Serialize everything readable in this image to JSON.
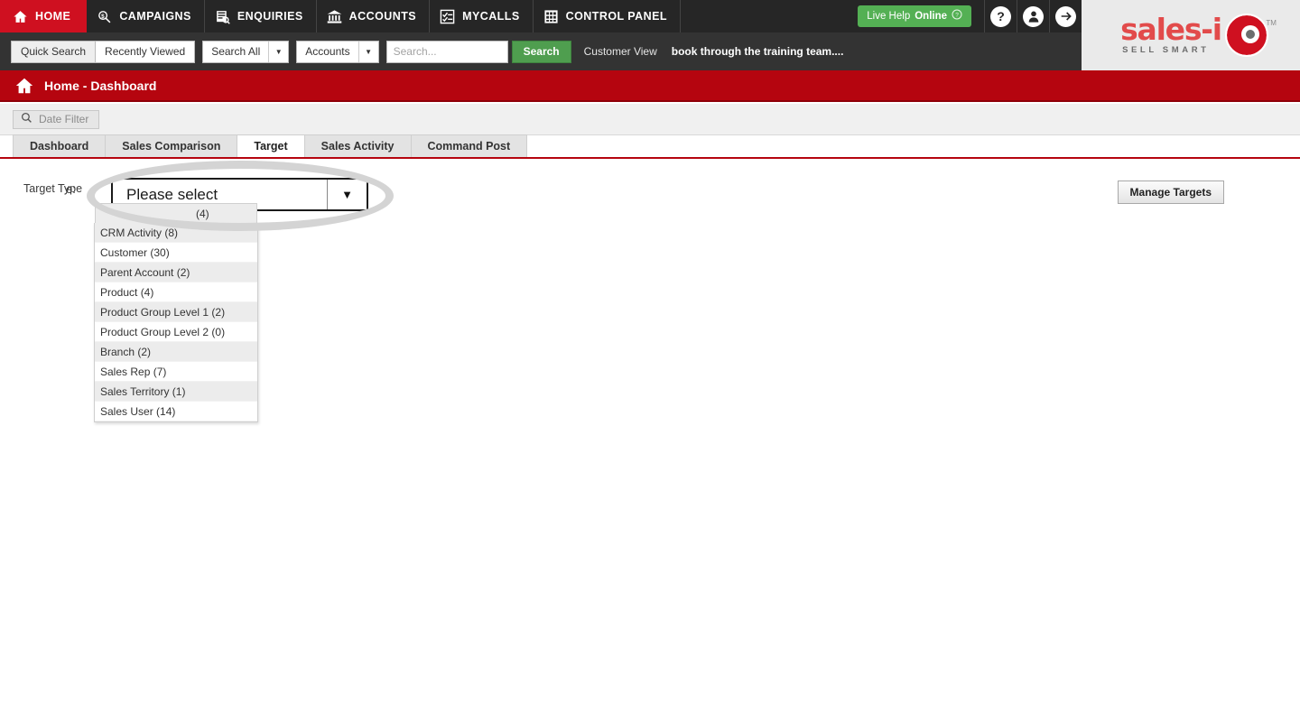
{
  "topnav": {
    "items": [
      {
        "label": "HOME",
        "icon": "home-icon",
        "active": true
      },
      {
        "label": "CAMPAIGNS",
        "icon": "campaigns-icon",
        "active": false
      },
      {
        "label": "ENQUIRIES",
        "icon": "enquiries-icon",
        "active": false
      },
      {
        "label": "ACCOUNTS",
        "icon": "accounts-bank-icon",
        "active": false
      },
      {
        "label": "MYCALLS",
        "icon": "mycalls-checklist-icon",
        "active": false
      },
      {
        "label": "CONTROL PANEL",
        "icon": "control-panel-grid-icon",
        "active": false
      }
    ],
    "live_help": {
      "prefix": "Live Help",
      "status": "Online",
      "icon": "help-circle-icon"
    },
    "help_icon": "question-mark-icon",
    "account_icon": "user-avatar-icon",
    "logout_icon": "arrow-right-logout-icon"
  },
  "logo": {
    "main": "sales-i",
    "sub": "SELL SMART",
    "trademark": "TM",
    "mark_icon": "eye-logo-icon",
    "brand_red": "#cf1020",
    "brand_text_red": "#e24b4b"
  },
  "searchbar": {
    "quick_search_label": "Quick Search",
    "recently_viewed_label": "Recently Viewed",
    "scope_label": "Search All",
    "entity_label": "Accounts",
    "search_placeholder": "Search...",
    "search_value": "",
    "search_button_label": "Search",
    "customer_view_label": "Customer View",
    "marquee_text": "book through the training team....",
    "search_green": "#4f9e4f"
  },
  "breadcrumb": {
    "icon": "home-icon",
    "title": "Home - Dashboard",
    "bar_red": "#b5050f"
  },
  "filterstrip": {
    "date_filter_label": "Date Filter",
    "date_filter_icon": "magnifier-icon"
  },
  "tabs": [
    {
      "label": "Dashboard",
      "active": false
    },
    {
      "label": "Sales Comparison",
      "active": false
    },
    {
      "label": "Target",
      "active": true
    },
    {
      "label": "Sales Activity",
      "active": false
    },
    {
      "label": "Command Post",
      "active": false
    }
  ],
  "main": {
    "target_type_label": "Target Type",
    "target_type_label_ghost": "e:",
    "select": {
      "value": "Please select",
      "arrow_icon": "chevron-down-icon"
    },
    "dropdown_options": [
      {
        "label": "(4)",
        "obscured": true
      },
      {
        "label": "CRM Activity (8)"
      },
      {
        "label": "Customer (30)"
      },
      {
        "label": "Parent Account (2)"
      },
      {
        "label": "Product (4)"
      },
      {
        "label": "Product Group Level 1 (2)"
      },
      {
        "label": "Product Group Level 2 (0)"
      },
      {
        "label": "Branch (2)"
      },
      {
        "label": "Sales Rep (7)"
      },
      {
        "label": "Sales Territory (1)"
      },
      {
        "label": "Sales User (14)"
      }
    ],
    "manage_targets_label": "Manage Targets",
    "annotation_oval_color": "#d4d4d4"
  }
}
